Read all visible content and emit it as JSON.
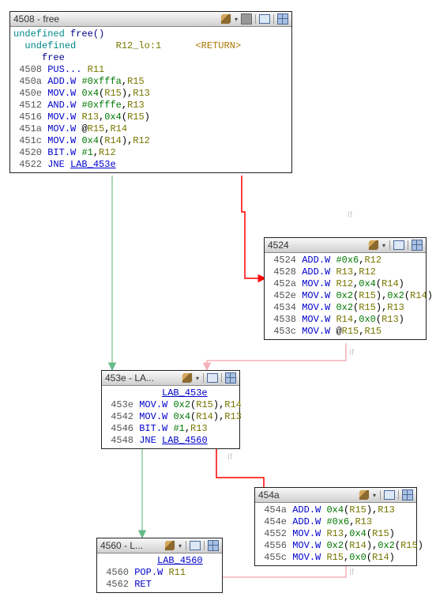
{
  "blocks": {
    "b1": {
      "title": "4508 - free",
      "header1_a": "undefined",
      "header1_b": "free()",
      "header2_a": "undefined",
      "header2_b": "R12_lo:1",
      "header2_c": "<RETURN>",
      "header3": "free",
      "lines": {
        "l0": {
          "addr": "4508",
          "mnem": "PUS...",
          "ops": [
            [
              "reg",
              "R11"
            ]
          ]
        },
        "l1": {
          "addr": "450a",
          "mnem": "ADD.W",
          "ops": [
            [
              "imm",
              "#0xfffa"
            ],
            [
              "txt",
              ","
            ],
            [
              "reg",
              "R15"
            ]
          ]
        },
        "l2": {
          "addr": "450e",
          "mnem": "MOV.W",
          "ops": [
            [
              "imm",
              "0x4"
            ],
            [
              "txt",
              "("
            ],
            [
              "reg",
              "R15"
            ],
            [
              "txt",
              ")"
            ],
            [
              "txt",
              ","
            ],
            [
              "reg",
              "R13"
            ]
          ]
        },
        "l3": {
          "addr": "4512",
          "mnem": "AND.W",
          "ops": [
            [
              "imm",
              "#0xfffe"
            ],
            [
              "txt",
              ","
            ],
            [
              "reg",
              "R13"
            ]
          ]
        },
        "l4": {
          "addr": "4516",
          "mnem": "MOV.W",
          "ops": [
            [
              "reg",
              "R13"
            ],
            [
              "txt",
              ","
            ],
            [
              "imm",
              "0x4"
            ],
            [
              "txt",
              "("
            ],
            [
              "reg",
              "R15"
            ],
            [
              "txt",
              ")"
            ]
          ]
        },
        "l5": {
          "addr": "451a",
          "mnem": "MOV.W",
          "ops": [
            [
              "txt",
              "@"
            ],
            [
              "reg",
              "R15"
            ],
            [
              "txt",
              ","
            ],
            [
              "reg",
              "R14"
            ]
          ]
        },
        "l6": {
          "addr": "451c",
          "mnem": "MOV.W",
          "ops": [
            [
              "imm",
              "0x4"
            ],
            [
              "txt",
              "("
            ],
            [
              "reg",
              "R14"
            ],
            [
              "txt",
              ")"
            ],
            [
              "txt",
              ","
            ],
            [
              "reg",
              "R12"
            ]
          ]
        },
        "l7": {
          "addr": "4520",
          "mnem": "BIT.W",
          "ops": [
            [
              "imm",
              "#1"
            ],
            [
              "txt",
              ","
            ],
            [
              "reg",
              "R12"
            ]
          ]
        },
        "l8": {
          "addr": "4522",
          "mnem": "JNE",
          "ops": [
            [
              "lbl",
              "LAB_453e"
            ]
          ]
        }
      }
    },
    "b2": {
      "title": "4524",
      "lines": {
        "l0": {
          "addr": "4524",
          "mnem": "ADD.W",
          "ops": [
            [
              "imm",
              "#0x6"
            ],
            [
              "txt",
              ","
            ],
            [
              "reg",
              "R12"
            ]
          ]
        },
        "l1": {
          "addr": "4528",
          "mnem": "ADD.W",
          "ops": [
            [
              "reg",
              "R13"
            ],
            [
              "txt",
              ","
            ],
            [
              "reg",
              "R12"
            ]
          ]
        },
        "l2": {
          "addr": "452a",
          "mnem": "MOV.W",
          "ops": [
            [
              "reg",
              "R12"
            ],
            [
              "txt",
              ","
            ],
            [
              "imm",
              "0x4"
            ],
            [
              "txt",
              "("
            ],
            [
              "reg",
              "R14"
            ],
            [
              "txt",
              ")"
            ]
          ]
        },
        "l3": {
          "addr": "452e",
          "mnem": "MOV.W",
          "ops": [
            [
              "imm",
              "0x2"
            ],
            [
              "txt",
              "("
            ],
            [
              "reg",
              "R15"
            ],
            [
              "txt",
              ")"
            ],
            [
              "txt",
              ","
            ],
            [
              "imm",
              "0x2"
            ],
            [
              "txt",
              "("
            ],
            [
              "reg",
              "R14"
            ],
            [
              "txt",
              ")"
            ]
          ]
        },
        "l4": {
          "addr": "4534",
          "mnem": "MOV.W",
          "ops": [
            [
              "imm",
              "0x2"
            ],
            [
              "txt",
              "("
            ],
            [
              "reg",
              "R15"
            ],
            [
              "txt",
              ")"
            ],
            [
              "txt",
              ","
            ],
            [
              "reg",
              "R13"
            ]
          ]
        },
        "l5": {
          "addr": "4538",
          "mnem": "MOV.W",
          "ops": [
            [
              "reg",
              "R14"
            ],
            [
              "txt",
              ","
            ],
            [
              "imm",
              "0x0"
            ],
            [
              "txt",
              "("
            ],
            [
              "reg",
              "R13"
            ],
            [
              "txt",
              ")"
            ]
          ]
        },
        "l6": {
          "addr": "453c",
          "mnem": "MOV.W",
          "ops": [
            [
              "txt",
              "@"
            ],
            [
              "reg",
              "R15"
            ],
            [
              "txt",
              ","
            ],
            [
              "reg",
              "R15"
            ]
          ]
        }
      }
    },
    "b3": {
      "title": "453e - LA...",
      "label": "LAB_453e",
      "lines": {
        "l0": {
          "addr": "453e",
          "mnem": "MOV.W",
          "ops": [
            [
              "imm",
              "0x2"
            ],
            [
              "txt",
              "("
            ],
            [
              "reg",
              "R15"
            ],
            [
              "txt",
              ")"
            ],
            [
              "txt",
              ","
            ],
            [
              "reg",
              "R14"
            ]
          ]
        },
        "l1": {
          "addr": "4542",
          "mnem": "MOV.W",
          "ops": [
            [
              "imm",
              "0x4"
            ],
            [
              "txt",
              "("
            ],
            [
              "reg",
              "R14"
            ],
            [
              "txt",
              ")"
            ],
            [
              "txt",
              ","
            ],
            [
              "reg",
              "R13"
            ]
          ]
        },
        "l2": {
          "addr": "4546",
          "mnem": "BIT.W",
          "ops": [
            [
              "imm",
              "#1"
            ],
            [
              "txt",
              ","
            ],
            [
              "reg",
              "R13"
            ]
          ]
        },
        "l3": {
          "addr": "4548",
          "mnem": "JNE",
          "ops": [
            [
              "lbl",
              "LAB_4560"
            ]
          ]
        }
      }
    },
    "b4": {
      "title": "454a",
      "lines": {
        "l0": {
          "addr": "454a",
          "mnem": "ADD.W",
          "ops": [
            [
              "imm",
              "0x4"
            ],
            [
              "txt",
              "("
            ],
            [
              "reg",
              "R15"
            ],
            [
              "txt",
              ")"
            ],
            [
              "txt",
              ","
            ],
            [
              "reg",
              "R13"
            ]
          ]
        },
        "l1": {
          "addr": "454e",
          "mnem": "ADD.W",
          "ops": [
            [
              "imm",
              "#0x6"
            ],
            [
              "txt",
              ","
            ],
            [
              "reg",
              "R13"
            ]
          ]
        },
        "l2": {
          "addr": "4552",
          "mnem": "MOV.W",
          "ops": [
            [
              "reg",
              "R13"
            ],
            [
              "txt",
              ","
            ],
            [
              "imm",
              "0x4"
            ],
            [
              "txt",
              "("
            ],
            [
              "reg",
              "R15"
            ],
            [
              "txt",
              ")"
            ]
          ]
        },
        "l3": {
          "addr": "4556",
          "mnem": "MOV.W",
          "ops": [
            [
              "imm",
              "0x2"
            ],
            [
              "txt",
              "("
            ],
            [
              "reg",
              "R14"
            ],
            [
              "txt",
              ")"
            ],
            [
              "txt",
              ","
            ],
            [
              "imm",
              "0x2"
            ],
            [
              "txt",
              "("
            ],
            [
              "reg",
              "R15"
            ],
            [
              "txt",
              ")"
            ]
          ]
        },
        "l4": {
          "addr": "455c",
          "mnem": "MOV.W",
          "ops": [
            [
              "reg",
              "R15"
            ],
            [
              "txt",
              ","
            ],
            [
              "imm",
              "0x0"
            ],
            [
              "txt",
              "("
            ],
            [
              "reg",
              "R14"
            ],
            [
              "txt",
              ")"
            ]
          ]
        }
      }
    },
    "b5": {
      "title": "4560 - L...",
      "label": "LAB_4560",
      "lines": {
        "l0": {
          "addr": "4560",
          "mnem": "POP.W",
          "ops": [
            [
              "reg",
              "R11"
            ]
          ]
        },
        "l1": {
          "addr": "4562",
          "mnem": "RET",
          "ops": []
        }
      }
    }
  },
  "edge_labels": {
    "if": "If"
  }
}
